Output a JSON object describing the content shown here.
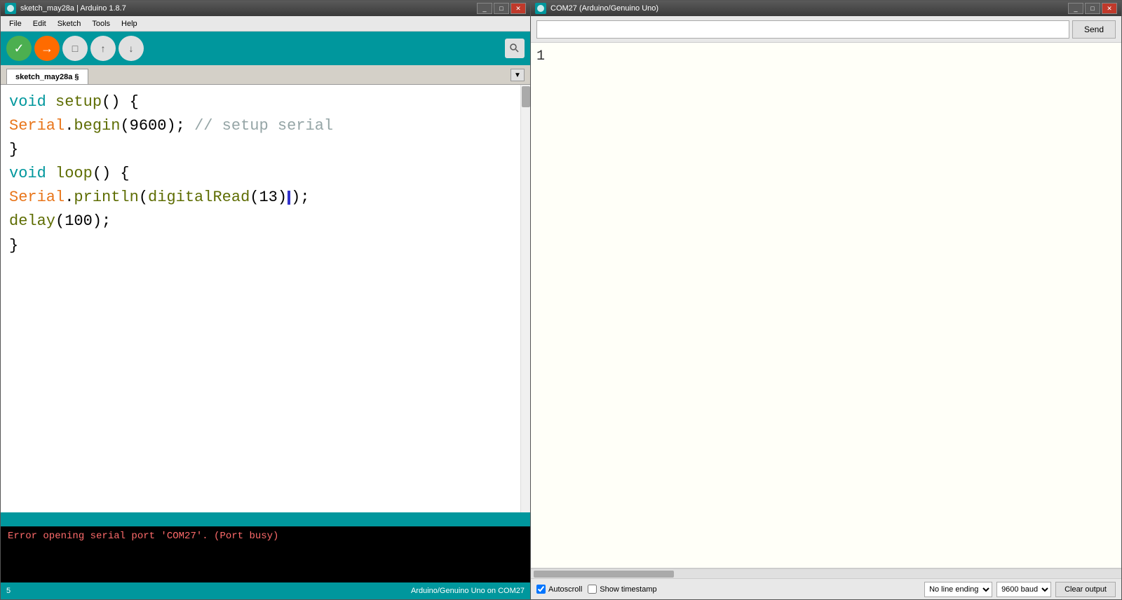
{
  "left_window": {
    "title": "sketch_may28a | Arduino 1.8.7",
    "menu": [
      "File",
      "Edit",
      "Sketch",
      "Tools",
      "Help"
    ],
    "tab_name": "sketch_may28a §",
    "code_lines": [
      {
        "type": "keyword_void",
        "text": "void setup() {"
      },
      {
        "type": "serial_begin",
        "text": "Serial.begin(9600); // setup serial"
      },
      {
        "type": "brace",
        "text": "}"
      },
      {
        "type": "keyword_void",
        "text": "void loop() {"
      },
      {
        "type": "serial_println",
        "text": "Serial.println(digitalRead(13));"
      },
      {
        "type": "delay",
        "text": "delay(100);"
      },
      {
        "type": "brace",
        "text": "}"
      }
    ],
    "error_text": "Error opening serial port 'COM27'. (Port busy)",
    "bottom_status": "Arduino/Genuino Uno on COM27",
    "line_count": "5"
  },
  "right_window": {
    "title": "COM27 (Arduino/Genuino Uno)",
    "send_label": "Send",
    "serial_output_line": "1",
    "autoscroll_label": "Autoscroll",
    "show_timestamp_label": "Show timestamp",
    "no_line_ending_label": "No line ending",
    "baud_rate_label": "9600 baud",
    "clear_output_label": "Clear output"
  }
}
